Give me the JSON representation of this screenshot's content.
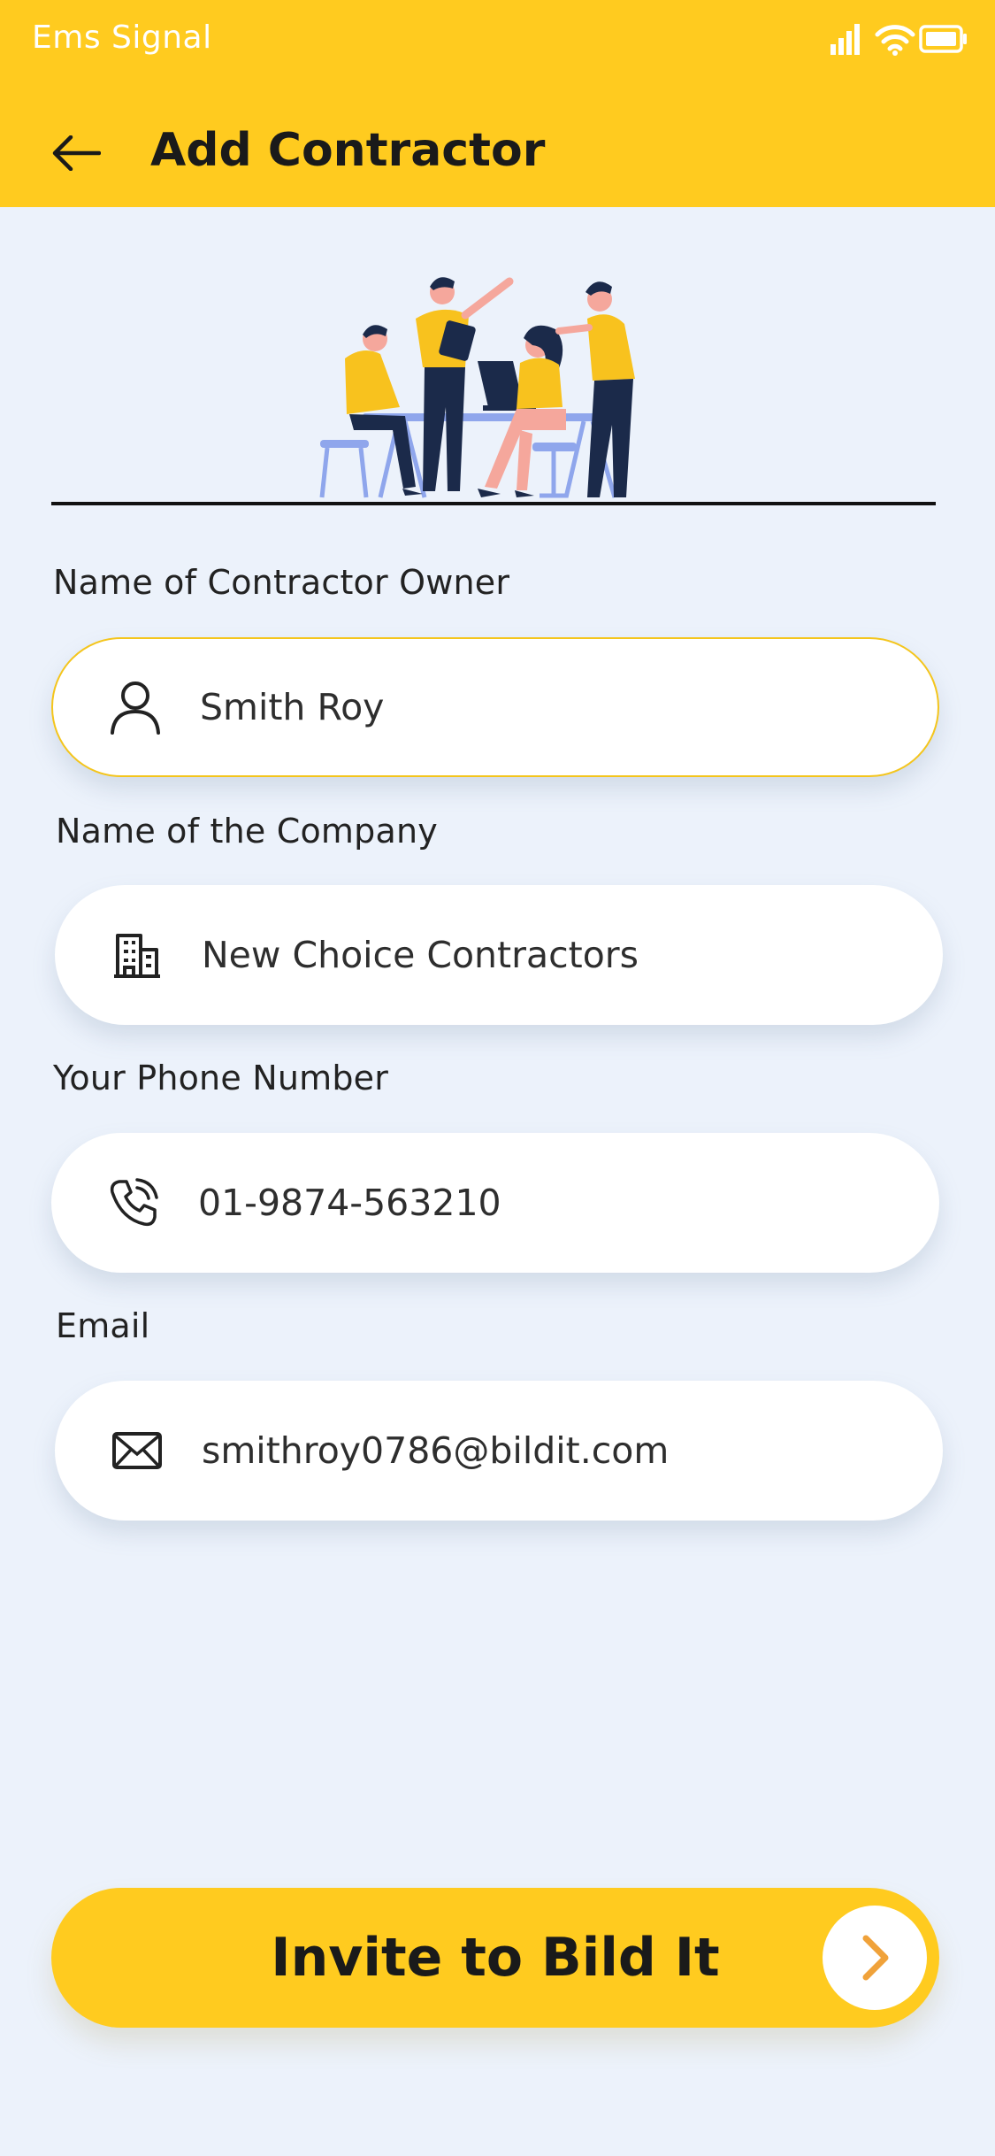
{
  "status_bar": {
    "carrier": "Ems Signal",
    "icons": [
      "signal-icon",
      "wifi-icon",
      "battery-icon"
    ]
  },
  "header": {
    "title": "Add Contractor",
    "back_icon": "arrow-left-icon"
  },
  "form": {
    "owner": {
      "label": "Name of Contractor Owner",
      "value": "Smith Roy",
      "icon": "person-icon"
    },
    "company": {
      "label": "Name of the Company",
      "value": "New Choice Contractors",
      "icon": "building-icon"
    },
    "phone": {
      "label": "Your Phone Number",
      "value": "01-9874-563210",
      "icon": "phone-icon"
    },
    "email": {
      "label": "Email",
      "value": "smithroy0786@bildit.com",
      "icon": "mail-icon"
    }
  },
  "cta": {
    "label": "Invite to Bild It",
    "icon": "chevron-right-icon"
  },
  "colors": {
    "accent": "#FFCB1F",
    "background": "#ECF2FB",
    "field": "#FFFFFF",
    "text": "#1A1A1A",
    "arrow": "#F0A23A"
  }
}
